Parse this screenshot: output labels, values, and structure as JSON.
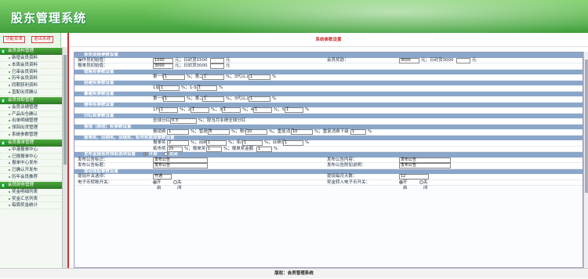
{
  "app": {
    "title": "股东管理系统"
  },
  "left_tabs": {
    "a": "功能菜单",
    "b": "退出系统"
  },
  "sidebar": {
    "g1": "会员资料管理",
    "g1_items": [
      "新增会员资料",
      "本周会员资料",
      "已审会员资料",
      "历年会员资料",
      "同期获利资料",
      "直配出货确认"
    ],
    "g2": "会员领取管理",
    "g2_items": [
      "会员业绩管理",
      "产品出仓确认",
      "出单明细管理",
      "领回出货管理",
      "系统参数管理"
    ],
    "g3": "会员报单管理",
    "g3_items": [
      "中港报单中心",
      "已报报单中心",
      "报单中心发布",
      "已确认开发布",
      "历年会员推荐"
    ],
    "g4": "会员财务管理",
    "g4_items": [
      "奖金明细列表",
      "奖金汇总列表",
      "每周奖金统计"
    ]
  },
  "main": {
    "heading": "系统参数设置",
    "s1": "会员资格参数设置",
    "r1": {
      "l1": "操作员初始值：",
      "v1": "1500",
      "m1": "元；日封顶1500",
      "u1": "元",
      "l2": "会员奖励：",
      "v2": "3000",
      "m2": "元；日封顶3000",
      "u2": "元"
    },
    "r2": {
      "l1": "报单员初始值：",
      "v1": "3000",
      "m1": "元；日封顶3000",
      "u1": "元"
    },
    "s2": "销售奖参数设置",
    "r3": {
      "t": "第一代",
      "v1": "1",
      "u1": "%；第二代",
      "v2": "1",
      "u2": "%；3代以上",
      "v3": "1",
      "u3": "%"
    },
    "s3": "层碰奖参数设置",
    "r4": {
      "t": "1层",
      "v1": "1",
      "u1": "%；1-5层",
      "v2": "1",
      "u2": "%"
    },
    "s4": "量碰奖参数设置",
    "r5": {
      "t": "第一代",
      "v1": "1",
      "u1": "%；第二代",
      "v2": "1",
      "u2": "%；3代以上",
      "v3": "1",
      "u3": "%"
    },
    "s5": "辅导奖参数设置",
    "r6": {
      "t": "1代",
      "v1": "1",
      "u1": "%；2代",
      "v2": "1",
      "u2": "%；3代",
      "v3": "1",
      "u3": "%；4代",
      "v4": "1",
      "u4": "%；5代",
      "v5": "1",
      "u5": "%"
    },
    "s6": "分红奖参数设置",
    "r7": {
      "t": "全球分红",
      "v1": "0.3",
      "u1": "%；按当月业绩全球分红"
    },
    "s7": "报销（税收）奖参数设置",
    "r8": {
      "t": "报销费",
      "v1": "1",
      "u1": "%；管理费",
      "v2": "8",
      "u2": "%；税收",
      "v3": "10",
      "u3": "%；重复消费",
      "v4": "10",
      "u4": "%；重复消费下级",
      "v5": "1",
      "u5": "%"
    },
    "s8": "报单奖、出纳奖、业绩奖、拓市奖提成参数设置",
    "r9": {
      "t": "报单奖",
      "v1": "2",
      "u1": "%；出纳",
      "v2": "1",
      "u2": "%；拓市",
      "v3": "1",
      "u3": "%；业绩奖",
      "v4": "1",
      "u4": "%"
    },
    "r10": {
      "t": "拓市奖",
      "v1": "25",
      "u1": "%；报单奖",
      "v2": "1",
      "u2": "%；报单奖金额",
      "v3": "1",
      "u3": "%"
    },
    "s9": "发布直接会员领取选项设置",
    "s9_on": "开启",
    "s9_off": "关闭",
    "r11": {
      "l1": "发布公告标识：",
      "v1": "发布公告",
      "l2": "发布公告内容：",
      "v2": "发布公告"
    },
    "r12": {
      "l1": "发布公告标题：",
      "v1": "发布公告",
      "l2": "发布公告附加说明：",
      "v2": "发布公告"
    },
    "s10": "提现领取参数设置",
    "r13": {
      "l1": "提现开关选项：",
      "v1": "开通",
      "l2": "提现每月天数：",
      "v2": "12"
    },
    "r14": {
      "l1": "电子币转账开关：",
      "on1": "开启",
      "off1": "关闭",
      "l2": "奖金转入电子币开关：",
      "on2": "开启",
      "off2": "关闭"
    }
  },
  "footer": {
    "text": "版权：会员管理系统"
  }
}
